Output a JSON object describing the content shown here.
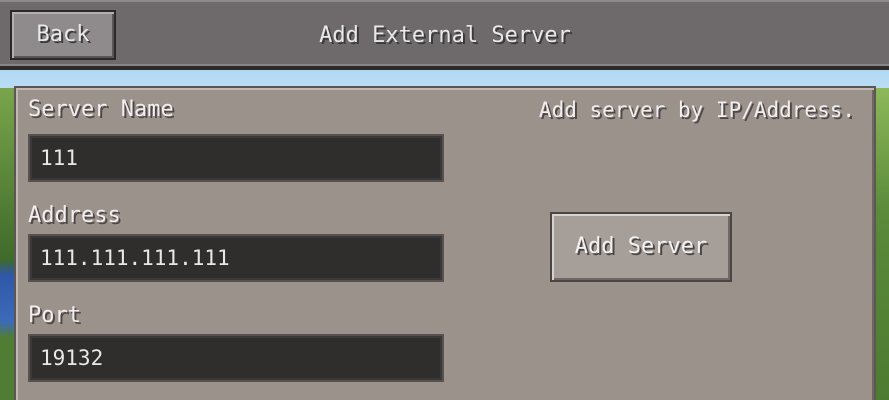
{
  "header": {
    "back_label": "Back",
    "title": "Add External Server"
  },
  "form": {
    "server_name_label": "Server Name",
    "server_name_value": "111",
    "address_label": "Address",
    "address_value": "111.111.111.111",
    "port_label": "Port",
    "port_value": "19132"
  },
  "side": {
    "hint": "Add server by IP/Address.",
    "add_button_label": "Add Server"
  },
  "colors": {
    "topbar": "#6e6a6b",
    "panel": "#9c928c",
    "field_bg": "#2f2e2d",
    "text": "#f0eeee"
  }
}
